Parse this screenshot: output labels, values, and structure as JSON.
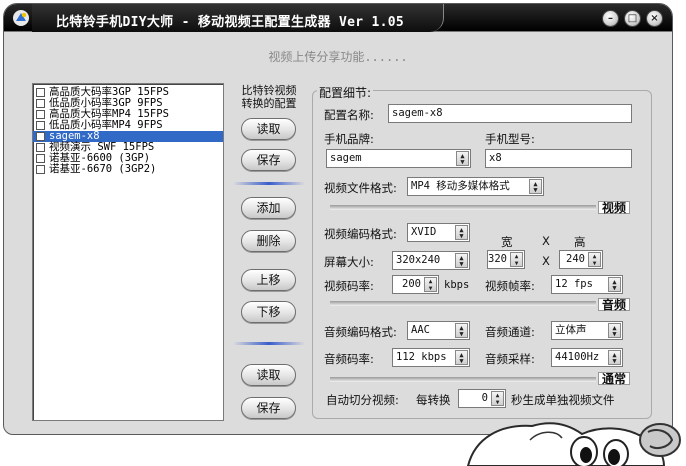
{
  "window": {
    "title": "比特铃手机DIY大师 - 移动视频王配置生成器 Ver 1.05",
    "banner": "视频上传分享功能......",
    "buttons": {
      "minimize": "–",
      "maximize": "□",
      "close": "×"
    }
  },
  "profiles": [
    {
      "label": "高品质大码率3GP 15FPS",
      "checked": false,
      "selected": false
    },
    {
      "label": "低品质小码率3GP  9FPS",
      "checked": false,
      "selected": false
    },
    {
      "label": "高品质大码率MP4 15FPS",
      "checked": false,
      "selected": false
    },
    {
      "label": "低品质小码率MP4  9FPS",
      "checked": false,
      "selected": false
    },
    {
      "label": "sagem-x8",
      "checked": false,
      "selected": true
    },
    {
      "label": "视频演示 SWF 15FPS",
      "checked": false,
      "selected": false
    },
    {
      "label": "诺基亚-6600 (3GP)",
      "checked": false,
      "selected": false
    },
    {
      "label": "诺基亚-6670 (3GP2)",
      "checked": false,
      "selected": false
    }
  ],
  "middle": {
    "caption_line1": "比特铃视频",
    "caption_line2": "转换的配置",
    "read_top": "读取",
    "save_top": "保存",
    "add": "添加",
    "delete": "删除",
    "move_up": "上移",
    "move_down": "下移",
    "read_bottom": "读取",
    "save_bottom": "保存"
  },
  "config": {
    "group_title": "配置细节:",
    "name_label": "配置名称:",
    "name_value": "sagem-x8",
    "brand_label": "手机品牌:",
    "brand_value": "sagem",
    "model_label": "手机型号:",
    "model_value": "x8",
    "format_label": "视频文件格式:",
    "format_value": "MP4 移动多媒体格式",
    "video_section": "视频",
    "vcodec_label": "视频编码格式:",
    "vcodec_value": "XVID",
    "width_label": "宽",
    "x_label": "X",
    "height_label": "高",
    "screen_label": "屏幕大小:",
    "screen_value": "320x240",
    "width_value": "320",
    "height_value": "240",
    "x_label2": "X",
    "vbitrate_label": "视频码率:",
    "vbitrate_value": "200",
    "vbitrate_unit": "kbps",
    "fps_label": "视频帧率:",
    "fps_value": "12 fps",
    "audio_section": "音频",
    "acodec_label": "音频编码格式:",
    "acodec_value": "AAC",
    "channel_label": "音频通道:",
    "channel_value": "立体声",
    "abitrate_label": "音频码率:",
    "abitrate_value": "112 kbps",
    "samplerate_label": "音频采样:",
    "samplerate_value": "44100Hz",
    "general_section": "通常",
    "split_label": "自动切分视频:",
    "split_every": "每转换",
    "split_value": "0",
    "split_suffix": "秒生成单独视频文件"
  },
  "colors": {
    "selection": "#3169c6",
    "accent_line": "#3a5ccc",
    "titlebar": "#000000"
  }
}
